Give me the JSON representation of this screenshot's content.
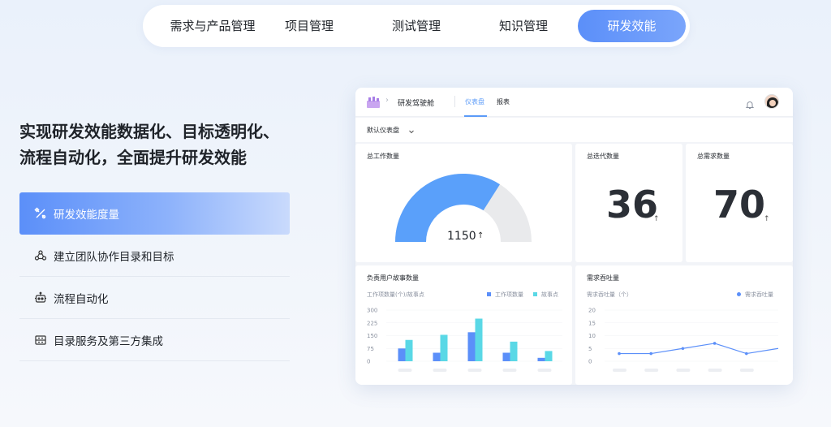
{
  "topnav": {
    "tabs": [
      {
        "label": "需求与产品管理"
      },
      {
        "label": "项目管理"
      },
      {
        "label": "测试管理"
      },
      {
        "label": "知识管理"
      },
      {
        "label": "研发效能"
      }
    ]
  },
  "hero": {
    "title_line1": "实现研发效能数据化、目标透明化、",
    "title_line2": "流程自动化，全面提升研发效能"
  },
  "features": [
    {
      "label": "研发效能度量",
      "icon": "measure-icon"
    },
    {
      "label": "建立团队协作目录和目标",
      "icon": "team-icon"
    },
    {
      "label": "流程自动化",
      "icon": "robot-icon"
    },
    {
      "label": "目录服务及第三方集成",
      "icon": "integration-icon"
    }
  ],
  "dashboard": {
    "breadcrumb": "研发驾驶舱",
    "tabs": [
      {
        "label": "仪表盘"
      },
      {
        "label": "报表"
      }
    ],
    "dashboard_select": "默认仪表盘",
    "accent": "#5b9bf8",
    "gauge": {
      "title": "总工作数量",
      "value": "1150",
      "fraction": 0.68,
      "color": "#5aa0fa",
      "track_color": "#e9eaec"
    },
    "iterations": {
      "title": "总迭代数量",
      "value": "36"
    },
    "requirements": {
      "title": "总需求数量",
      "value": "70"
    },
    "story_chart": {
      "title": "负责用户故事数量",
      "subtitle": "工作项数量(个)/故事点",
      "legend": [
        {
          "name": "工作项数量",
          "color": "#5b8ff9"
        },
        {
          "name": "故事点",
          "color": "#5ad8e6"
        }
      ]
    },
    "throughput_chart": {
      "title": "需求吞吐量",
      "subtitle": "需求吞吐量（个）",
      "legend": [
        {
          "name": "需求吞吐量",
          "color": "#5b8ff9"
        }
      ]
    }
  },
  "chart_data": [
    {
      "type": "bar",
      "title": "负责用户故事数量",
      "ylabel": "工作项数量(个)/故事点",
      "ylim": [
        0,
        300
      ],
      "yticks": [
        "0",
        "75",
        "150",
        "225",
        "300"
      ],
      "categories": [
        "",
        "",
        "",
        "",
        ""
      ],
      "series": [
        {
          "name": "工作项数量",
          "values": [
            75,
            50,
            170,
            50,
            20
          ]
        },
        {
          "name": "故事点",
          "values": [
            125,
            155,
            250,
            115,
            60
          ]
        }
      ]
    },
    {
      "type": "line",
      "title": "需求吞吐量",
      "ylabel": "需求吞吐量（个）",
      "ylim": [
        0,
        20
      ],
      "yticks": [
        "0",
        "5",
        "10",
        "15",
        "20"
      ],
      "x": [
        "",
        "",
        "",
        "",
        "",
        ""
      ],
      "series": [
        {
          "name": "需求吞吐量",
          "values": [
            3,
            3,
            5,
            7,
            3,
            5
          ]
        }
      ]
    }
  ]
}
